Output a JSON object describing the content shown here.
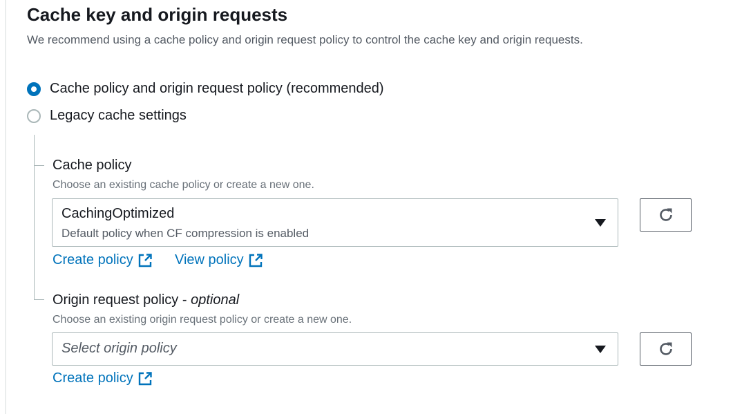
{
  "section": {
    "title": "Cache key and origin requests",
    "description": "We recommend using a cache policy and origin request policy to control the cache key and origin requests."
  },
  "radios": [
    {
      "label": "Cache policy and origin request policy (recommended)",
      "checked": true
    },
    {
      "label": "Legacy cache settings",
      "checked": false
    }
  ],
  "cache_policy": {
    "label": "Cache policy",
    "hint": "Choose an existing cache policy or create a new one.",
    "selected_value": "CachingOptimized",
    "selected_description": "Default policy when CF compression is enabled",
    "links": {
      "create": "Create policy",
      "view": "View policy"
    }
  },
  "origin_request_policy": {
    "label": "Origin request policy",
    "label_separator": " - ",
    "label_optional": "optional",
    "hint": "Choose an existing origin request policy or create a new one.",
    "placeholder": "Select origin policy",
    "links": {
      "create": "Create policy"
    }
  },
  "icons": {
    "caret": "caret-down-icon",
    "refresh": "refresh-icon",
    "external": "external-link-icon"
  },
  "colors": {
    "link": "#0073bb",
    "radio_checked": "#0073bb",
    "text": "#16191f",
    "secondary_text": "#545b64",
    "border": "#aab7b8"
  }
}
